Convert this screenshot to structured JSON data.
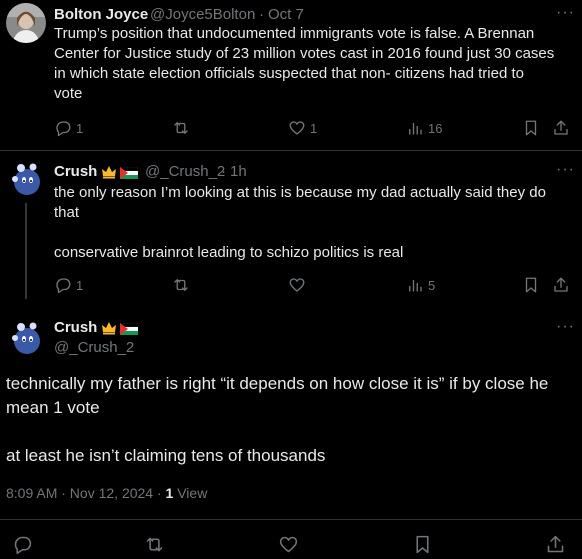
{
  "tweets": [
    {
      "name": "Bolton Joyce",
      "handle": "@Joyce5Bolton",
      "sep": "·",
      "time": "Oct 7",
      "lines": [
        "Trump’s position that undocumented immigrants vote is false. A Brennan",
        "Center for Justice study of 23 million votes cast in 2016 found just 30 cases",
        "in which state election officials suspected that non- citizens had tried to",
        "vote"
      ],
      "replies": "1",
      "likes": "1",
      "views": "16"
    },
    {
      "name": "Crush",
      "handle": "@_Crush_2",
      "sep": "·",
      "time": "1h",
      "paragraphs": [
        [
          "the only reason I’m looking at this is because my dad actually said they do",
          "that"
        ],
        [
          "conservative brainrot leading to schizo politics is real"
        ]
      ],
      "replies": "1",
      "views": "5"
    }
  ],
  "main": {
    "name": "Crush",
    "handle": "@_Crush_2",
    "paragraphs": [
      [
        "technically my father is right “it depends on how close it is” if by close he",
        "mean 1 vote"
      ],
      [
        "at least he isn’t claiming tens of thousands"
      ]
    ],
    "timestamp": "8:09 AM · Nov 12, 2024 · ",
    "views_count": "1",
    "views_label": "View"
  },
  "more_glyph": "···",
  "colors": {
    "background": "#000000",
    "text": "#e7e9ea",
    "muted": "#71767b",
    "divider": "#2f3336",
    "crown": "#f7b731",
    "flag_green": "#149954",
    "flag_red": "#e4312b"
  },
  "icons": [
    "reply-icon",
    "retweet-icon",
    "like-icon",
    "views-icon",
    "bookmark-icon",
    "share-icon",
    "more-icon",
    "crown-emoji",
    "flag-emoji"
  ]
}
